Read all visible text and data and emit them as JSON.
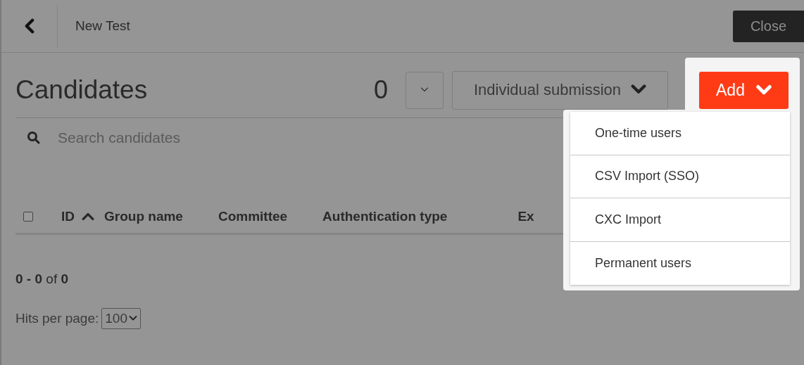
{
  "header": {
    "title": "New Test",
    "close_label": "Close"
  },
  "toolbar": {
    "title": "Candidates",
    "count": "0",
    "mode_select": "Individual submission",
    "add_label": "Add",
    "add_menu_open": true
  },
  "add_menu": [
    {
      "label": "One-time users"
    },
    {
      "label": "CSV Import (SSO)"
    },
    {
      "label": "CXC Import"
    },
    {
      "label": "Permanent users"
    }
  ],
  "search": {
    "placeholder": "Search candidates"
  },
  "table": {
    "select_all_checked": false,
    "columns": [
      {
        "label": "ID",
        "sorted": true
      },
      {
        "label": "Group name",
        "sorted": false
      },
      {
        "label": "Committee",
        "sorted": false
      },
      {
        "label": "Authentication type",
        "sorted": false
      },
      {
        "label": "Ex",
        "sorted": false
      }
    ]
  },
  "pagination": {
    "range": "**0 - 0** of **0**",
    "hits_label": "Hits per page:",
    "hits_value": "100"
  }
}
